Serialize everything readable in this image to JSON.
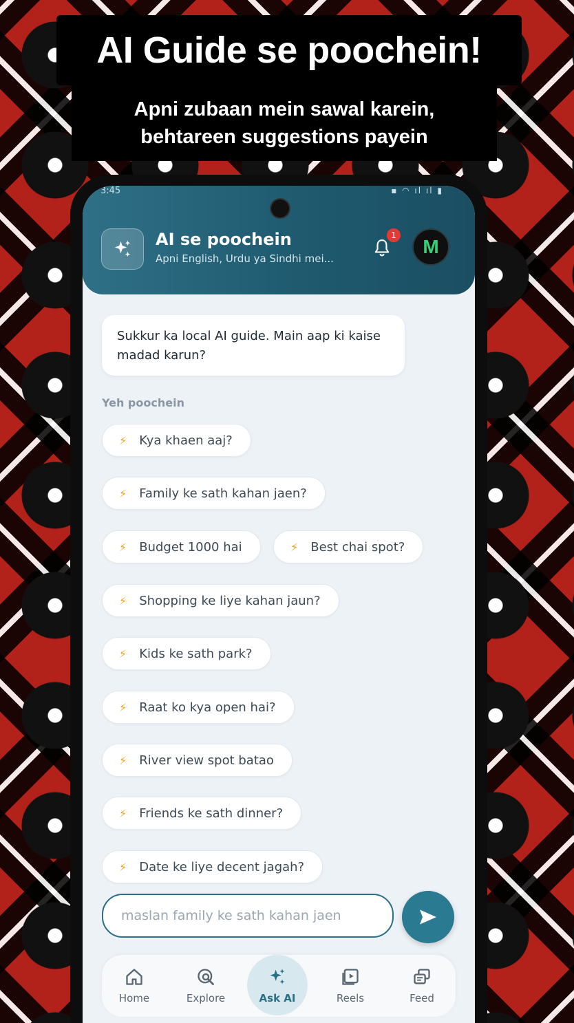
{
  "promo": {
    "title": "AI Guide se poochein!",
    "subtitle_line1": "Apni zubaan mein sawal karein,",
    "subtitle_line2": "behtareen suggestions payein"
  },
  "status_bar": {
    "time": "3:45"
  },
  "header": {
    "title": "AI se poochein",
    "subtitle": "Apni English, Urdu ya Sindhi mei...",
    "notification_count": "1",
    "avatar_letter": "M",
    "icons": [
      "sparkles-icon",
      "bell-icon"
    ]
  },
  "chat": {
    "greeting": "Sukkur ka local AI guide. Main aap ki kaise madad karun?"
  },
  "suggestions": {
    "label": "Yeh poochein",
    "items": [
      "Kya khaen aaj?",
      "Family ke sath kahan jaen?",
      "Budget 1000 hai",
      "Best chai spot?",
      "Shopping ke liye kahan jaun?",
      "Kids ke sath park?",
      "Raat ko kya open hai?",
      "River view spot batao",
      "Friends ke sath dinner?",
      "Date ke liye decent jagah?"
    ]
  },
  "composer": {
    "placeholder": "maslan family ke sath kahan jaen"
  },
  "nav": {
    "items": [
      "Home",
      "Explore",
      "Ask AI",
      "Reels",
      "Feed"
    ],
    "active": "Ask AI"
  },
  "colors": {
    "header_teal": "#1f5a6f",
    "accent": "#2a7a92",
    "bolt": "#f4a21a",
    "badge": "#e53935",
    "background_red": "#b2221b"
  }
}
